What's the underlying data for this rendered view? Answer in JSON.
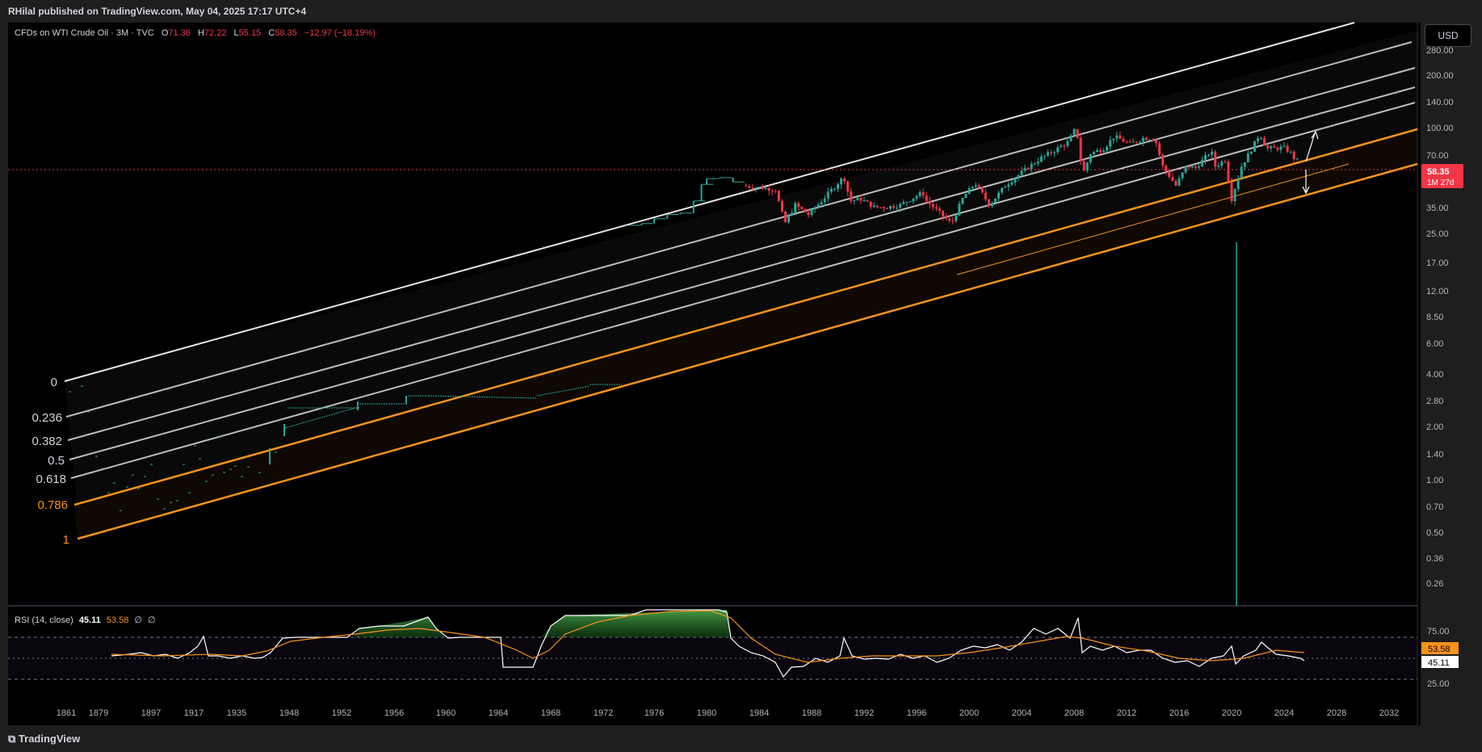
{
  "header": {
    "published": "RHilal published on TradingView.com, May 04, 2025 17:17 UTC+4"
  },
  "legend": {
    "symbol": "CFDs on WTI Crude Oil · 3M · TVC",
    "o_label": "O",
    "o": "71.36",
    "h_label": "H",
    "h": "72.22",
    "l_label": "L",
    "l": "55.15",
    "c_label": "C",
    "c": "58.35",
    "change": "−12.97 (−18.19%)"
  },
  "currency": "USD",
  "price_badge": {
    "price": "58.35",
    "countdown": "1M 27d"
  },
  "rsi": {
    "label": "RSI (14, close)",
    "value": "45.11",
    "ma": "53.58",
    "na1": "∅",
    "na2": "∅",
    "axis": [
      "75.00",
      "25.00"
    ]
  },
  "footer": {
    "brand": "TradingView"
  },
  "colors": {
    "background": "#000000",
    "up": "#26a69a",
    "down": "#f23645",
    "fib_orange": "#f7931a",
    "rsi_line": "#ffffff",
    "rsi_ma": "#f7931a",
    "rsi_overbought_fill": "#2e7d32"
  },
  "chart_data": {
    "type": "candlestick",
    "price_scale": "log",
    "x_ticks": [
      "1861",
      "1879",
      "1897",
      "1917",
      "1935",
      "1948",
      "1952",
      "1956",
      "1960",
      "1964",
      "1968",
      "1972",
      "1976",
      "1980",
      "1984",
      "1988",
      "1992",
      "1996",
      "2000",
      "2004",
      "2008",
      "2012",
      "2016",
      "2020",
      "2024",
      "2028",
      "2032"
    ],
    "y_ticks": [
      "280.00",
      "200.00",
      "140.00",
      "100.00",
      "70.00",
      "35.00",
      "25.00",
      "17.00",
      "12.00",
      "8.50",
      "6.00",
      "4.00",
      "2.80",
      "2.00",
      "1.40",
      "1.00",
      "0.70",
      "0.50",
      "0.36",
      "0.26"
    ],
    "fib_channel_levels": [
      "0",
      "0.236",
      "0.382",
      "0.5",
      "0.618",
      "0.786",
      "1"
    ],
    "last_close": 58.35,
    "approx_close_series": [
      {
        "x": "1861",
        "y": 0.6
      },
      {
        "x": "1879",
        "y": 0.9
      },
      {
        "x": "1897",
        "y": 0.8
      },
      {
        "x": "1917",
        "y": 1.3
      },
      {
        "x": "1935",
        "y": 0.9
      },
      {
        "x": "1948",
        "y": 2.6
      },
      {
        "x": "1956",
        "y": 2.9
      },
      {
        "x": "1964",
        "y": 2.9
      },
      {
        "x": "1972",
        "y": 3.6
      },
      {
        "x": "1976",
        "y": 12
      },
      {
        "x": "1980",
        "y": 37
      },
      {
        "x": "1984",
        "y": 29
      },
      {
        "x": "1986",
        "y": 11
      },
      {
        "x": "1990",
        "y": 33
      },
      {
        "x": "1994",
        "y": 17
      },
      {
        "x": "1998",
        "y": 12
      },
      {
        "x": "2000",
        "y": 26
      },
      {
        "x": "2004",
        "y": 45
      },
      {
        "x": "2008",
        "y": 140
      },
      {
        "x": "2009",
        "y": 45
      },
      {
        "x": "2012",
        "y": 95
      },
      {
        "x": "2015",
        "y": 45
      },
      {
        "x": "2016",
        "y": 30
      },
      {
        "x": "2018",
        "y": 70
      },
      {
        "x": "2020",
        "y": 20
      },
      {
        "x": "2022",
        "y": 110
      },
      {
        "x": "2024",
        "y": 75
      },
      {
        "x": "2025",
        "y": 58.35
      }
    ]
  }
}
